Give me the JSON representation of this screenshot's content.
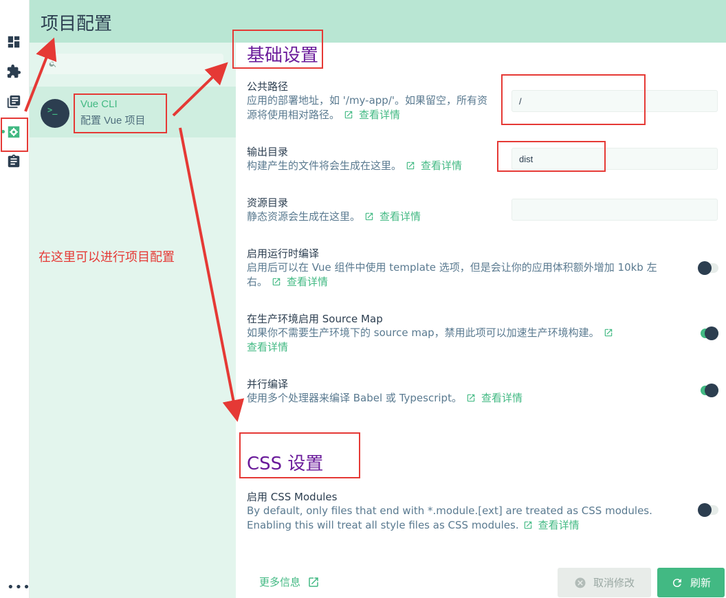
{
  "nav": {
    "items": [
      {
        "name": "dashboard",
        "icon": "dashboard-icon"
      },
      {
        "name": "plugins",
        "icon": "puzzle-icon"
      },
      {
        "name": "dependencies",
        "icon": "library-books-icon"
      },
      {
        "name": "configuration",
        "icon": "settings-icon",
        "active": true
      },
      {
        "name": "tasks",
        "icon": "clipboard-icon"
      }
    ],
    "more_label": "•••"
  },
  "header": {
    "title": "项目配置"
  },
  "panel": {
    "search": {
      "placeholder": "",
      "value": ""
    },
    "plugin": {
      "avatar_text": ">_",
      "name": "Vue CLI",
      "description": "配置 Vue 项目"
    }
  },
  "annotation": {
    "text": "在这里可以进行项目配置",
    "color": "#e53935"
  },
  "sections": [
    {
      "title": "基础设置",
      "prompts": [
        {
          "label": "公共路径",
          "description": "应用的部署地址，如 '/my-app/'。如果留空，所有资源将使用相对路径。",
          "link": "查看详情",
          "type": "input",
          "value": "/"
        },
        {
          "label": "输出目录",
          "description": "构建产生的文件将会生成在这里。",
          "link": "查看详情",
          "type": "input",
          "value": "dist"
        },
        {
          "label": "资源目录",
          "description": "静态资源会生成在这里。",
          "link": "查看详情",
          "type": "input",
          "value": ""
        },
        {
          "label": "启用运行时编译",
          "description": "启用后可以在 Vue 组件中使用 template 选项，但是会让你的应用体积额外增加 10kb 左右。",
          "link": "查看详情",
          "type": "toggle",
          "checked": false
        },
        {
          "label": "在生产环境启用 Source Map",
          "description": "如果你不需要生产环境下的 source map，禁用此项可以加速生产环境构建。",
          "link": "查看详情",
          "type": "toggle",
          "checked": true
        },
        {
          "label": "并行编译",
          "description": "使用多个处理器来编译 Babel 或 Typescript。",
          "link": "查看详情",
          "type": "toggle",
          "checked": true
        }
      ]
    },
    {
      "title": "CSS 设置",
      "prompts": [
        {
          "label": "启用 CSS Modules",
          "description": "By default, only files that end with *.module.[ext] are treated as CSS modules. Enabling this will treat all style files as CSS modules.",
          "link": "查看详情",
          "type": "toggle",
          "checked": false
        }
      ]
    }
  ],
  "footer": {
    "more_info": "更多信息",
    "cancel": "取消修改",
    "refresh": "刷新"
  },
  "colors": {
    "accent": "#42b983",
    "header_bg": "#b9e6d3",
    "panel_bg": "#e3f5ed",
    "section_title": "#6a1b9a",
    "annotation": "#e53935"
  }
}
